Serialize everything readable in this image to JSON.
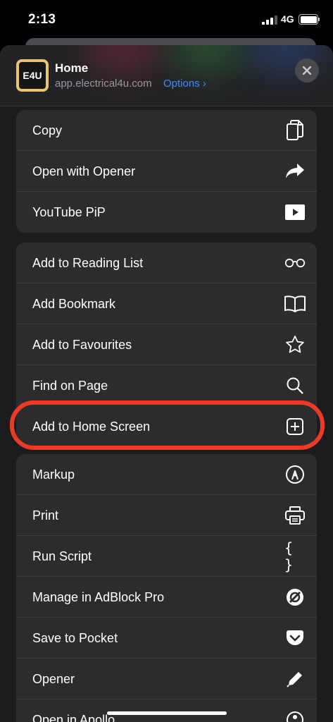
{
  "status_bar": {
    "time": "2:13",
    "network": "4G"
  },
  "header": {
    "app_icon_text": "E4U",
    "title": "Home",
    "url": "app.electrical4u.com",
    "options_label": "Options",
    "options_chevron": "›"
  },
  "groups": [
    {
      "items": [
        {
          "label": "Copy",
          "icon": "copy-icon"
        },
        {
          "label": "Open with Opener",
          "icon": "share-arrow-icon"
        },
        {
          "label": "YouTube PiP",
          "icon": "play-icon"
        }
      ]
    },
    {
      "items": [
        {
          "label": "Add to Reading List",
          "icon": "glasses-icon"
        },
        {
          "label": "Add Bookmark",
          "icon": "book-icon"
        },
        {
          "label": "Add to Favourites",
          "icon": "star-icon"
        },
        {
          "label": "Find on Page",
          "icon": "search-icon"
        },
        {
          "label": "Add to Home Screen",
          "icon": "add-square-icon"
        }
      ]
    },
    {
      "items": [
        {
          "label": "Markup",
          "icon": "markup-icon"
        },
        {
          "label": "Print",
          "icon": "printer-icon"
        },
        {
          "label": "Run Script",
          "icon": "braces-icon"
        },
        {
          "label": "Manage in AdBlock Pro",
          "icon": "block-icon"
        },
        {
          "label": "Save to Pocket",
          "icon": "pocket-icon"
        },
        {
          "label": "Opener",
          "icon": "pencil-icon"
        },
        {
          "label": "Open in Apollo",
          "icon": "apollo-icon"
        }
      ]
    }
  ],
  "run_script_glyph": "{ }",
  "highlight_color": "#eb3a26",
  "link_color": "#3b8cff"
}
